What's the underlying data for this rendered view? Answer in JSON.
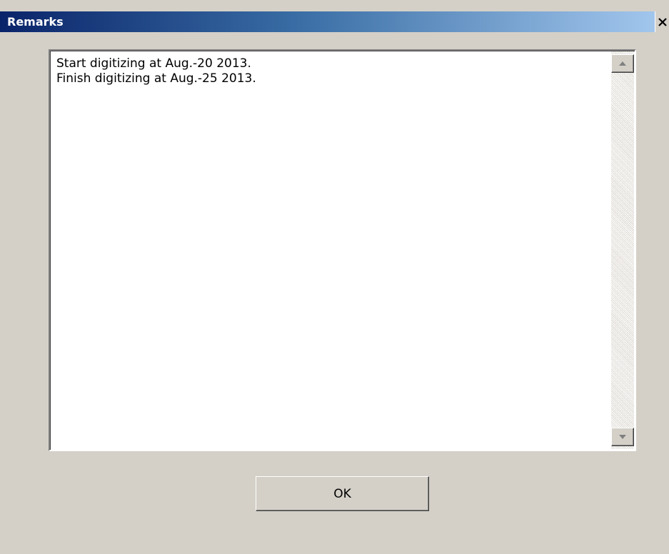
{
  "window": {
    "title": "Remarks",
    "close_icon": "close-icon"
  },
  "memo": {
    "lines": [
      "Start digitizing at Aug.-20 2013.",
      "Finish digitizing at Aug.-25 2013."
    ],
    "scroll_up_icon": "arrow-up-icon",
    "scroll_down_icon": "arrow-down-icon"
  },
  "buttons": {
    "ok_label": "OK"
  },
  "colors": {
    "title_gradient_start": "#0a246a",
    "title_gradient_end": "#a6caf0",
    "window_face": "#d4d0c8"
  }
}
